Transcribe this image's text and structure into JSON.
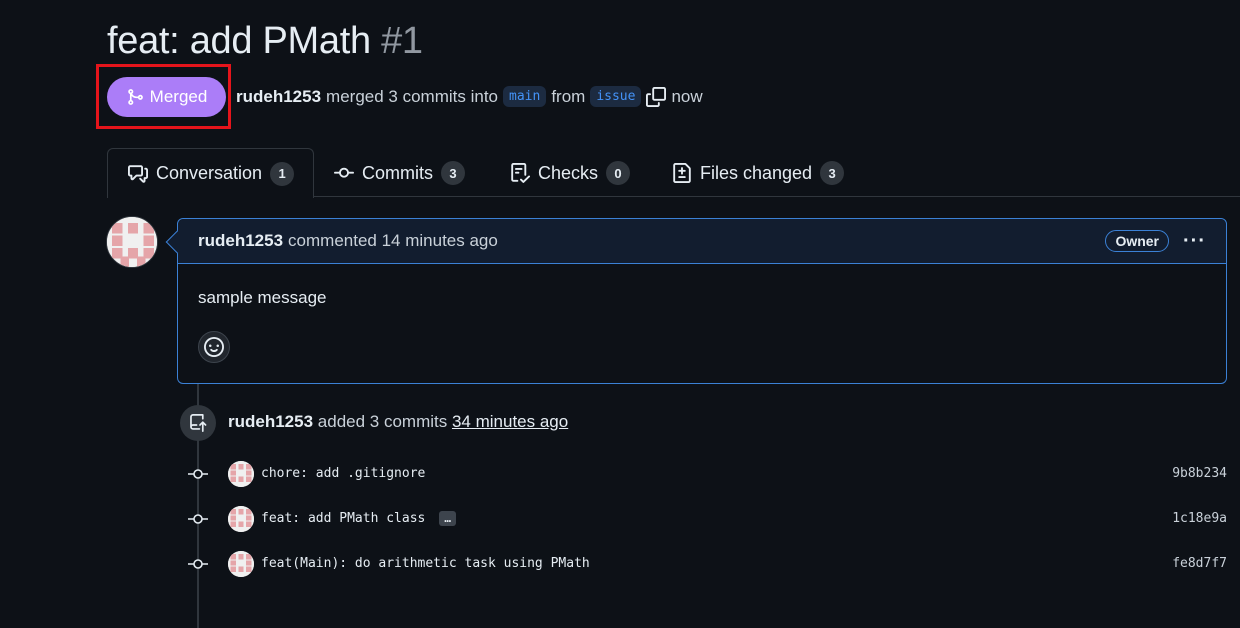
{
  "pr": {
    "title": "feat: add PMath",
    "number": "#1",
    "state_label": "Merged",
    "author": "rudeh1253",
    "action_text": "merged 3 commits into",
    "base_branch": "main",
    "from_text": "from",
    "head_branch": "issue",
    "time": "now"
  },
  "tabs": [
    {
      "label": "Conversation",
      "count": "1",
      "icon": "comment-discussion-icon",
      "active": true
    },
    {
      "label": "Commits",
      "count": "3",
      "icon": "git-commit-icon"
    },
    {
      "label": "Checks",
      "count": "0",
      "icon": "checklist-icon"
    },
    {
      "label": "Files changed",
      "count": "3",
      "icon": "file-diff-icon"
    }
  ],
  "comment": {
    "author": "rudeh1253",
    "action": "commented 14 minutes ago",
    "role_badge": "Owner",
    "body": "sample message",
    "menu_icon": "kebab-horizontal-icon",
    "reaction_icon": "smiley-icon"
  },
  "push_event": {
    "author": "rudeh1253",
    "action": "added 3 commits",
    "time": "34 minutes ago"
  },
  "commits": [
    {
      "message": "chore: add .gitignore",
      "sha": "9b8b234",
      "has_more": false
    },
    {
      "message": "feat: add PMath class",
      "sha": "1c18e9a",
      "has_more": true,
      "more_label": "…"
    },
    {
      "message": "feat(Main): do arithmetic task using PMath",
      "sha": "fe8d7f7",
      "has_more": false
    }
  ],
  "colors": {
    "merged": "#ab7df8",
    "highlight": "#e5141b",
    "accent_border": "#3b81d6",
    "background": "#0d1117"
  }
}
